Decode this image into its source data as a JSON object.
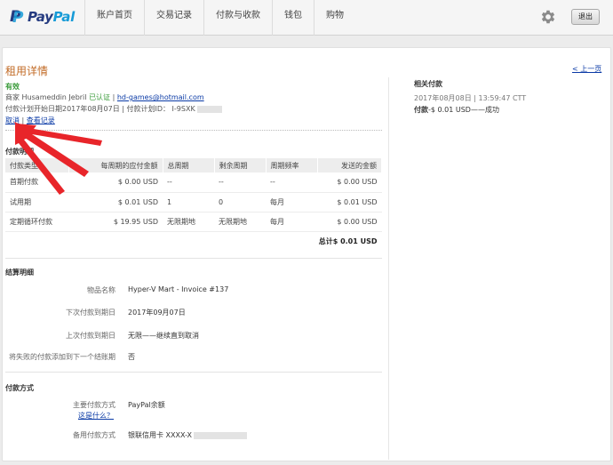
{
  "header": {
    "logo": {
      "pay": "Pay",
      "pal": "Pal"
    },
    "nav": [
      "账户首页",
      "交易记录",
      "付款与收款",
      "钱包",
      "购物"
    ],
    "logout_label": "退出"
  },
  "details": {
    "title": "租用详情",
    "status": "有效",
    "merchant_prefix": "商家",
    "merchant_name": "Husameddin Jebril",
    "verified": "已认证",
    "separator": "|",
    "merchant_email": "hd-games@hotmail.com",
    "plan_line": "付款计划开始日期2017年08月07日 | 付款计划ID： I-9SXK",
    "cancel_link": "取消",
    "history_link": "查看记录",
    "back_link": "< 上一页"
  },
  "payment_details": {
    "section_title": "付款明细",
    "columns": [
      "付款类型",
      "每周期的应付金额",
      "总周期",
      "剩余周期",
      "周期频率",
      "发送的金额"
    ],
    "rows": [
      [
        "首期付款",
        "$ 0.00 USD",
        "--",
        "--",
        "--",
        "$ 0.00 USD"
      ],
      [
        "试用期",
        "$ 0.01 USD",
        "1",
        "0",
        "每月",
        "$ 0.01 USD"
      ],
      [
        "定期循环付款",
        "$ 19.95 USD",
        "无限期地",
        "无限期地",
        "每月",
        "$ 0.00 USD"
      ]
    ],
    "total_label": "总计",
    "total_value": "$ 0.01 USD"
  },
  "billing_details": {
    "section_title": "结算明细",
    "rows": [
      {
        "label": "物品名称",
        "value": "Hyper-V Mart - Invoice #137"
      },
      {
        "label": "下次付款到期日",
        "value": "2017年09月07日"
      },
      {
        "label": "上次付款到期日",
        "value": "无限——继续直到取消"
      },
      {
        "label": "将失败的付款添加到下一个结账期",
        "value": "否"
      }
    ]
  },
  "payment_method": {
    "section_title": "付款方式",
    "primary_label": "主要付款方式",
    "primary_value": "PayPal余额",
    "whats_this": "这是什么？",
    "backup_label": "备用付款方式",
    "backup_value": "银联信用卡 XXXX-X"
  },
  "related": {
    "title": "相关付款",
    "datetime": "2017年08月08日 | 13:59:47 CTT",
    "payment_label": "付款",
    "payment_value": "-$ 0.01 USD——成功"
  },
  "colors": {
    "title_orange": "#c26b26",
    "verified_green": "#3a9b3a",
    "link_blue": "#0a3aa6",
    "arrow_red": "#e8252a"
  }
}
